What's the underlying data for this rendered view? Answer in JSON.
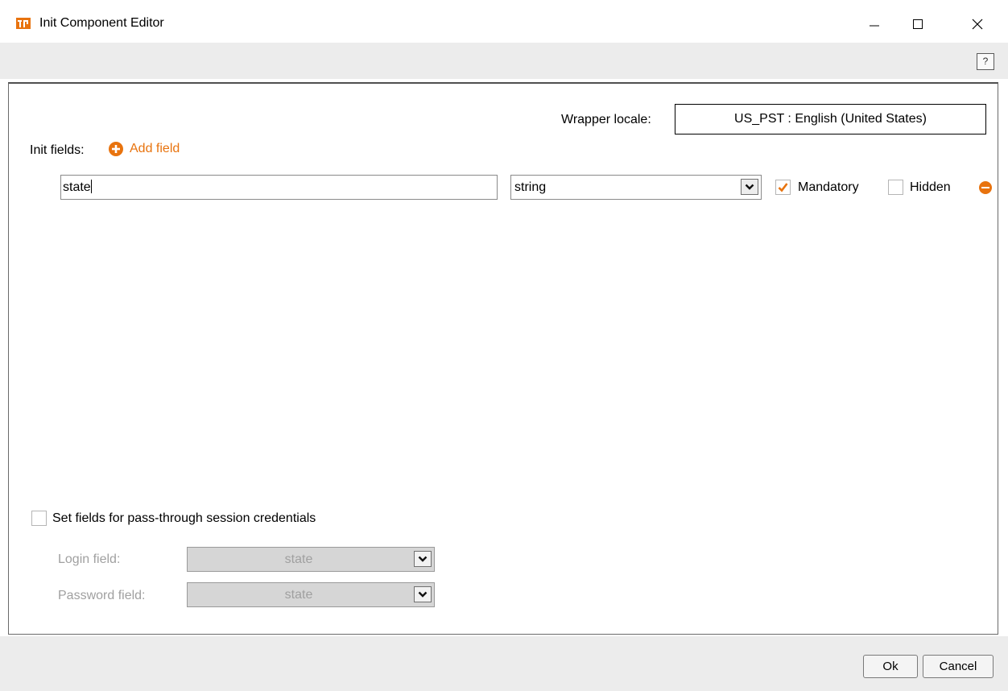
{
  "window": {
    "title": "Init Component Editor",
    "controls": {
      "minimize": "—",
      "maximize": "☐",
      "close": "✕"
    }
  },
  "help": {
    "label": "?"
  },
  "locale": {
    "label": "Wrapper locale:",
    "value": "US_PST :  English (United States)"
  },
  "init_fields": {
    "label": "Init fields:",
    "add_label": "Add field",
    "rows": [
      {
        "name": "state",
        "type": "string",
        "mandatory": true,
        "mandatory_label": "Mandatory",
        "hidden": false,
        "hidden_label": "Hidden"
      }
    ]
  },
  "passthrough": {
    "checkbox_label": "Set fields for pass-through session credentials",
    "checked": false,
    "login_label": "Login field:",
    "login_value": "state",
    "password_label": "Password field:",
    "password_value": "state"
  },
  "buttons": {
    "ok": "Ok",
    "cancel": "Cancel"
  },
  "colors": {
    "accent": "#e8730e",
    "toolbar": "#ececec",
    "disabled_text": "#a0a0a0"
  },
  "icons": [
    "app-logo-icon",
    "minimize-icon",
    "maximize-icon",
    "close-icon",
    "help-icon",
    "add-circle-icon",
    "dropdown-chevron-icon",
    "checkmark-icon",
    "remove-circle-icon"
  ]
}
